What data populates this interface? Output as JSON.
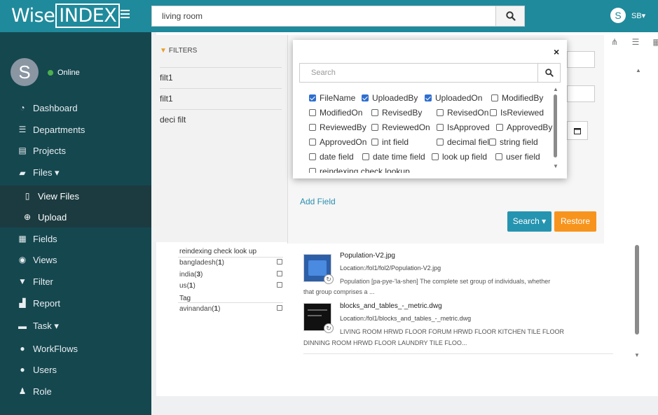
{
  "header": {
    "logo_text": "Wise",
    "logo_box": "INDEX",
    "search_value": "living room",
    "user_initial": "S",
    "user_name": "SB▾"
  },
  "sidebar": {
    "avatar_initial": "S",
    "status": "Online",
    "items": [
      {
        "label": "Dashboard",
        "icon": "dashboard-icon"
      },
      {
        "label": "Departments",
        "icon": "departments-icon"
      },
      {
        "label": "Projects",
        "icon": "projects-icon"
      },
      {
        "label": "Files ▾",
        "icon": "files-icon"
      },
      {
        "label": "View Files",
        "icon": "file-icon"
      },
      {
        "label": "Upload",
        "icon": "upload-icon"
      },
      {
        "label": "Fields",
        "icon": "fields-icon"
      },
      {
        "label": "Views",
        "icon": "views-icon"
      },
      {
        "label": "Filter",
        "icon": "filter-icon"
      },
      {
        "label": "Report",
        "icon": "report-icon"
      },
      {
        "label": "Task ▾",
        "icon": "task-icon"
      },
      {
        "label": "WorkFlows",
        "icon": "workflows-icon"
      },
      {
        "label": "Users",
        "icon": "users-icon"
      },
      {
        "label": "Role",
        "icon": "role-icon"
      }
    ]
  },
  "filters": {
    "title": "FILTERS",
    "items": [
      "filt1",
      "filt1",
      "deci filt"
    ]
  },
  "search_panel": {
    "add_field": "Add Field",
    "search_btn": "Search ▾",
    "restore_btn": "Restore"
  },
  "modal": {
    "close": "×",
    "search_placeholder": "Search",
    "fields": [
      {
        "label": "FileName",
        "checked": true
      },
      {
        "label": "UploadedBy",
        "checked": true
      },
      {
        "label": "UploadedOn",
        "checked": true
      },
      {
        "label": "ModifiedBy",
        "checked": false
      },
      {
        "label": "ModifiedOn",
        "checked": false
      },
      {
        "label": "RevisedBy",
        "checked": false
      },
      {
        "label": "RevisedOn",
        "checked": false
      },
      {
        "label": "IsReviewed",
        "checked": false
      },
      {
        "label": "ReviewedBy",
        "checked": false
      },
      {
        "label": "ReviewedOn",
        "checked": false
      },
      {
        "label": "IsApproved",
        "checked": false
      },
      {
        "label": "ApprovedBy",
        "checked": false
      },
      {
        "label": "ApprovedOn",
        "checked": false
      },
      {
        "label": "int field",
        "checked": false
      },
      {
        "label": "decimal field",
        "checked": false
      },
      {
        "label": "string field",
        "checked": false
      },
      {
        "label": "date field",
        "checked": false
      },
      {
        "label": "date time field",
        "checked": false
      },
      {
        "label": "look up field",
        "checked": false
      },
      {
        "label": "user field",
        "checked": false
      },
      {
        "label": "reindexing check lookup",
        "checked": false
      }
    ]
  },
  "facets": {
    "group1_title": "reindexing check look up",
    "group1": [
      {
        "label": "bangladesh",
        "count": "1"
      },
      {
        "label": "india",
        "count": "3"
      },
      {
        "label": "us",
        "count": "1"
      }
    ],
    "group2_title": "Tag",
    "group2": [
      {
        "label": "avinandan",
        "count": "1"
      }
    ]
  },
  "results": [
    {
      "title": "Population-V2.jpg",
      "location": "Location:/fol1/fol2/Population-V2.jpg",
      "desc_line1": "Population [pa-pye-'la-shen] The complete set group of individuals, whether",
      "desc_line2": "that group comprises a ..."
    },
    {
      "title": "blocks_and_tables_-_metric.dwg",
      "location": "Location:/fol1/blocks_and_tables_-_metric.dwg",
      "desc_line1": "LIVING ROOM HRWD FLOOR FORUM HRWD FLOOR KITCHEN TILE FLOOR",
      "desc_line2": "DINNING ROOM HRWD FLOOR LAUNDRY TILE FLOO..."
    }
  ],
  "colors": {
    "topbar": "#1f8a9c",
    "sidebar": "#15474f",
    "search_btn": "#2594b0",
    "restore_btn": "#f7941e",
    "checkbox_on": "#2f6fcf"
  }
}
